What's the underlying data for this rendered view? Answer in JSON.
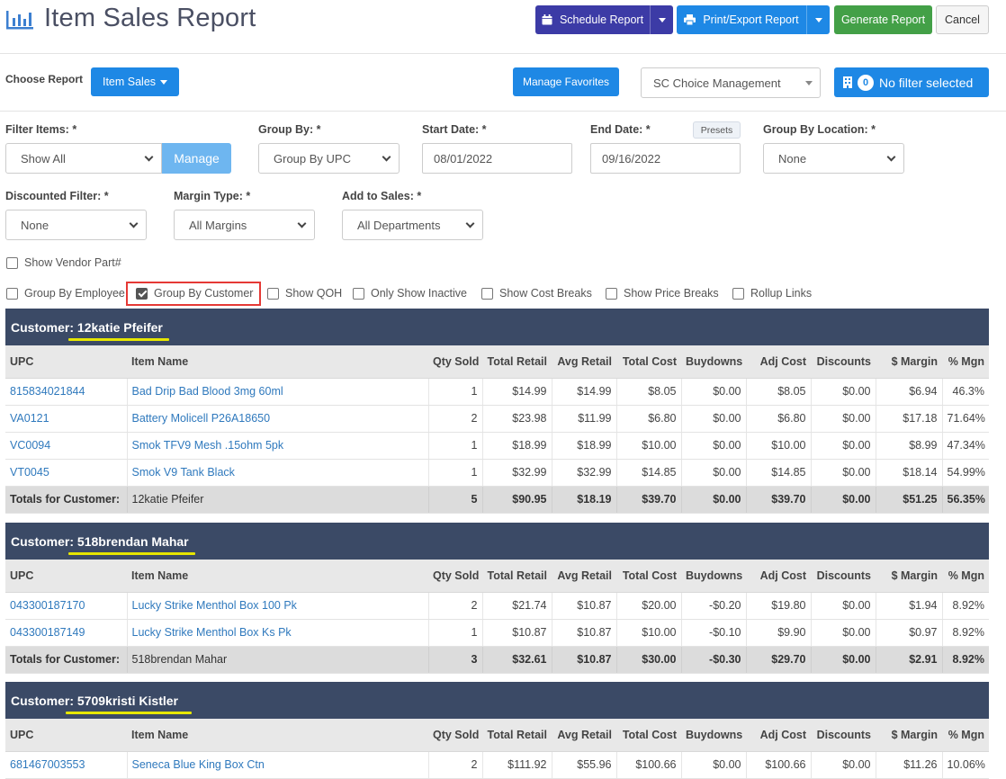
{
  "header": {
    "title": "Item Sales Report",
    "schedule_label": "Schedule Report",
    "print_label": "Print/Export Report",
    "generate_label": "Generate Report",
    "cancel_label": "Cancel"
  },
  "choose": {
    "label": "Choose Report",
    "report_button": "Item Sales",
    "favorites_button": "Manage Favorites",
    "location_select": "SC Choice Management",
    "filter_count": "0",
    "filter_label": "No filter selected"
  },
  "filters": {
    "filter_items": {
      "label": "Filter Items: *",
      "value": "Show All",
      "manage_button": "Manage"
    },
    "group_by": {
      "label": "Group By: *",
      "value": "Group By UPC"
    },
    "start_date": {
      "label": "Start Date: *",
      "value": "08/01/2022"
    },
    "end_date": {
      "label": "End Date: *",
      "value": "09/16/2022",
      "presets_button": "Presets"
    },
    "group_by_location": {
      "label": "Group By Location: *",
      "value": "None"
    },
    "discounted": {
      "label": "Discounted Filter: *",
      "value": "None"
    },
    "margin_type": {
      "label": "Margin Type: *",
      "value": "All Margins"
    },
    "add_to_sales": {
      "label": "Add to Sales: *",
      "value": "All Departments"
    }
  },
  "checkboxes": {
    "show_vendor_part": {
      "label": "Show Vendor Part#",
      "checked": false
    },
    "group_by_employee": {
      "label": "Group By Employee",
      "checked": false
    },
    "group_by_customer": {
      "label": "Group By Customer",
      "checked": true
    },
    "show_qoh": {
      "label": "Show QOH",
      "checked": false
    },
    "only_show_inactive": {
      "label": "Only Show Inactive",
      "checked": false
    },
    "show_cost_breaks": {
      "label": "Show Cost Breaks",
      "checked": false
    },
    "show_price_breaks": {
      "label": "Show Price Breaks",
      "checked": false
    },
    "rollup_links": {
      "label": "Rollup Links",
      "checked": false
    }
  },
  "columns": [
    "UPC",
    "Item Name",
    "Qty Sold",
    "Total Retail",
    "Avg Retail",
    "Total Cost",
    "Buydowns",
    "Adj Cost",
    "Discounts",
    "$ Margin",
    "% Mgn"
  ],
  "totals_label": "Totals for Customer:",
  "customer_prefix": "Customer:",
  "groups": [
    {
      "customer": "12katie Pfeifer",
      "rows": [
        [
          "815834021844",
          "Bad Drip Bad Blood 3mg 60ml",
          "1",
          "$14.99",
          "$14.99",
          "$8.05",
          "$0.00",
          "$8.05",
          "$0.00",
          "$6.94",
          "46.3%"
        ],
        [
          "VA0121",
          "Battery Molicell P26A18650",
          "2",
          "$23.98",
          "$11.99",
          "$6.80",
          "$0.00",
          "$6.80",
          "$0.00",
          "$17.18",
          "71.64%"
        ],
        [
          "VC0094",
          "Smok TFV9 Mesh .15ohm 5pk",
          "1",
          "$18.99",
          "$18.99",
          "$10.00",
          "$0.00",
          "$10.00",
          "$0.00",
          "$8.99",
          "47.34%"
        ],
        [
          "VT0045",
          "Smok V9 Tank Black",
          "1",
          "$32.99",
          "$32.99",
          "$14.85",
          "$0.00",
          "$14.85",
          "$0.00",
          "$18.14",
          "54.99%"
        ]
      ],
      "totals": [
        "12katie Pfeifer",
        "5",
        "$90.95",
        "$18.19",
        "$39.70",
        "$0.00",
        "$39.70",
        "$0.00",
        "$51.25",
        "56.35%"
      ]
    },
    {
      "customer": "518brendan Mahar",
      "rows": [
        [
          "043300187170",
          "Lucky Strike Menthol Box 100 Pk",
          "2",
          "$21.74",
          "$10.87",
          "$20.00",
          "-$0.20",
          "$19.80",
          "$0.00",
          "$1.94",
          "8.92%"
        ],
        [
          "043300187149",
          "Lucky Strike Menthol Box Ks Pk",
          "1",
          "$10.87",
          "$10.87",
          "$10.00",
          "-$0.10",
          "$9.90",
          "$0.00",
          "$0.97",
          "8.92%"
        ]
      ],
      "totals": [
        "518brendan Mahar",
        "3",
        "$32.61",
        "$10.87",
        "$30.00",
        "-$0.30",
        "$29.70",
        "$0.00",
        "$2.91",
        "8.92%"
      ]
    },
    {
      "customer": "5709kristi Kistler",
      "rows": [
        [
          "681467003553",
          "Seneca Blue King Box Ctn",
          "2",
          "$111.92",
          "$55.96",
          "$100.66",
          "$0.00",
          "$100.66",
          "$0.00",
          "$11.26",
          "10.06%"
        ]
      ],
      "totals": null
    }
  ]
}
